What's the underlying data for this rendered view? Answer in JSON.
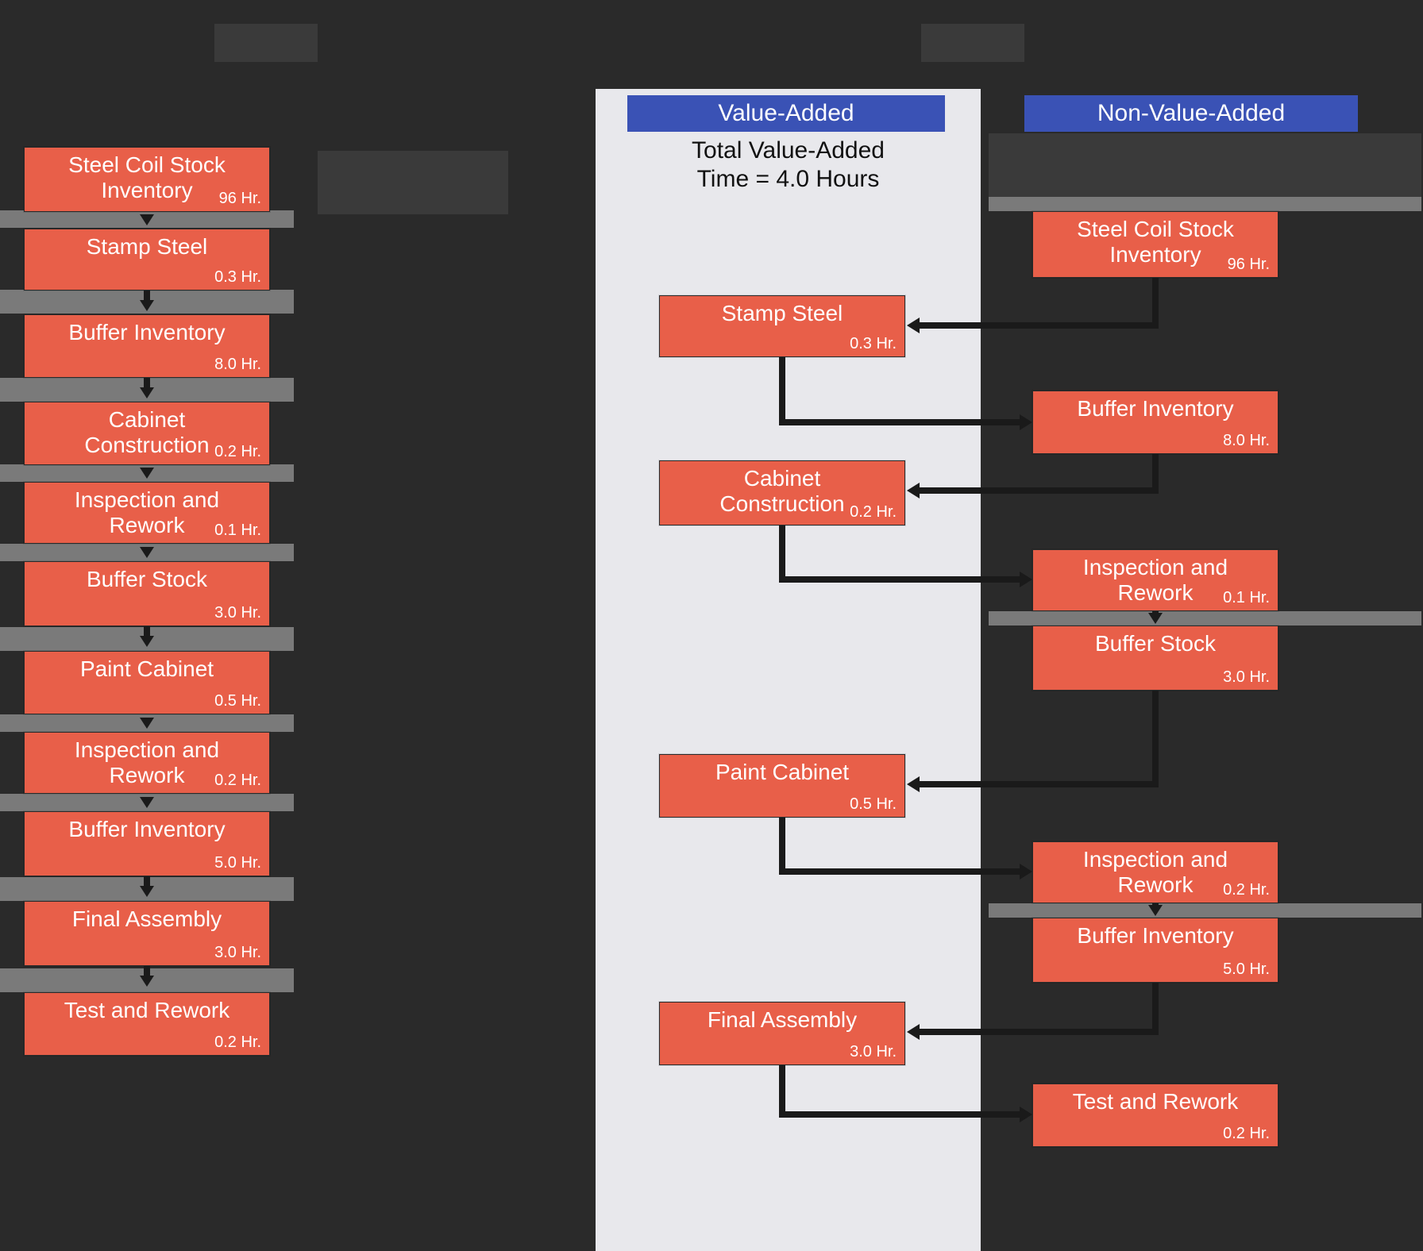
{
  "chart_data": {
    "type": "flow",
    "left_sequence": [
      {
        "name": "Steel Coil Stock Inventory",
        "hours": 96
      },
      {
        "name": "Stamp Steel",
        "hours": 0.3
      },
      {
        "name": "Buffer Inventory",
        "hours": 8.0
      },
      {
        "name": "Cabinet Construction",
        "hours": 0.2
      },
      {
        "name": "Inspection and Rework",
        "hours": 0.1
      },
      {
        "name": "Buffer Stock",
        "hours": 3.0
      },
      {
        "name": "Paint Cabinet",
        "hours": 0.5
      },
      {
        "name": "Inspection and Rework",
        "hours": 0.2
      },
      {
        "name": "Buffer Inventory",
        "hours": 5.0
      },
      {
        "name": "Final Assembly",
        "hours": 3.0
      },
      {
        "name": "Test and Rework",
        "hours": 0.2
      }
    ],
    "right_value_added": {
      "total_hours": 4.0,
      "steps": [
        {
          "name": "Stamp Steel",
          "hours": 0.3
        },
        {
          "name": "Cabinet Construction",
          "hours": 0.2
        },
        {
          "name": "Paint Cabinet",
          "hours": 0.5
        },
        {
          "name": "Final Assembly",
          "hours": 3.0
        }
      ]
    },
    "right_non_value_added": {
      "steps": [
        {
          "name": "Steel Coil Stock Inventory",
          "hours": 96
        },
        {
          "name": "Buffer Inventory",
          "hours": 8.0
        },
        {
          "name": "Inspection and Rework",
          "hours": 0.1
        },
        {
          "name": "Buffer Stock",
          "hours": 3.0
        },
        {
          "name": "Inspection and Rework",
          "hours": 0.2
        },
        {
          "name": "Buffer Inventory",
          "hours": 5.0
        },
        {
          "name": "Test and Rework",
          "hours": 0.2
        }
      ]
    }
  },
  "headers": {
    "value_added": "Value-Added",
    "non_value_added": "Non-Value-Added",
    "va_total_line1": "Total Value-Added",
    "va_total_line2": "Time = 4.0 Hours"
  },
  "left": {
    "b0": {
      "t": "Steel Coil Stock\nInventory",
      "d": "96 Hr."
    },
    "b1": {
      "t": "Stamp Steel",
      "d": "0.3 Hr."
    },
    "b2": {
      "t": "Buffer Inventory",
      "d": "8.0 Hr."
    },
    "b3": {
      "t": "Cabinet\nConstruction",
      "d": "0.2 Hr."
    },
    "b4": {
      "t": "Inspection and\nRework",
      "d": "0.1 Hr."
    },
    "b5": {
      "t": "Buffer Stock",
      "d": "3.0 Hr."
    },
    "b6": {
      "t": "Paint Cabinet",
      "d": "0.5 Hr."
    },
    "b7": {
      "t": "Inspection and\nRework",
      "d": "0.2 Hr."
    },
    "b8": {
      "t": "Buffer Inventory",
      "d": "5.0 Hr."
    },
    "b9": {
      "t": "Final Assembly",
      "d": "3.0 Hr."
    },
    "b10": {
      "t": "Test and Rework",
      "d": "0.2 Hr."
    }
  },
  "va": {
    "s0": {
      "t": "Stamp Steel",
      "d": "0.3 Hr."
    },
    "s1": {
      "t": "Cabinet\nConstruction",
      "d": "0.2 Hr."
    },
    "s2": {
      "t": "Paint Cabinet",
      "d": "0.5 Hr."
    },
    "s3": {
      "t": "Final Assembly",
      "d": "3.0 Hr."
    }
  },
  "nva": {
    "n0": {
      "t": "Steel Coil Stock\nInventory",
      "d": "96 Hr."
    },
    "n1": {
      "t": "Buffer Inventory",
      "d": "8.0 Hr."
    },
    "n2": {
      "t": "Inspection and\nRework",
      "d": "0.1 Hr."
    },
    "n3": {
      "t": "Buffer Stock",
      "d": "3.0 Hr."
    },
    "n4": {
      "t": "Inspection and\nRework",
      "d": "0.2 Hr."
    },
    "n5": {
      "t": "Buffer Inventory",
      "d": "5.0 Hr."
    },
    "n6": {
      "t": "Test and Rework",
      "d": "0.2 Hr."
    }
  }
}
